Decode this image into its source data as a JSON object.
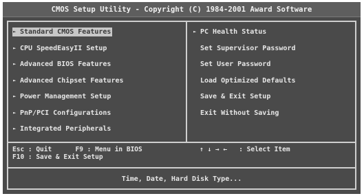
{
  "title": "CMOS Setup Utility - Copyright (C) 1984-2001 Award Software",
  "left_menu": [
    {
      "label": "Standard CMOS Features",
      "arrow": true,
      "selected": true
    },
    {
      "label": "CPU SpeedEasyII Setup",
      "arrow": true
    },
    {
      "label": "Advanced BIOS Features",
      "arrow": true
    },
    {
      "label": "Advanced Chipset Features",
      "arrow": true
    },
    {
      "label": "Power Management Setup",
      "arrow": true
    },
    {
      "label": "PnP/PCI Configurations",
      "arrow": true
    },
    {
      "label": "Integrated Peripherals",
      "arrow": true
    }
  ],
  "right_menu": [
    {
      "label": "PC Health Status",
      "arrow": true
    },
    {
      "label": "Set Supervisor Password",
      "arrow": false
    },
    {
      "label": "Set User Password",
      "arrow": false
    },
    {
      "label": "Load Optimized Defaults",
      "arrow": false
    },
    {
      "label": "Save & Exit Setup",
      "arrow": false
    },
    {
      "label": "Exit Without Saving",
      "arrow": false
    }
  ],
  "help": {
    "line1": "Esc : Quit      F9 : Menu in BIOS",
    "line2": "F10 : Save & Exit Setup",
    "nav": "↑ ↓ → ←   : Select Item"
  },
  "status": "Time, Date, Hard Disk Type...",
  "icons": {
    "submenu_arrow": "►"
  },
  "colors": {
    "screen_bg": "#4a4a4a",
    "text": "#e6e6e6",
    "highlight_bg": "#c8c8c8"
  }
}
